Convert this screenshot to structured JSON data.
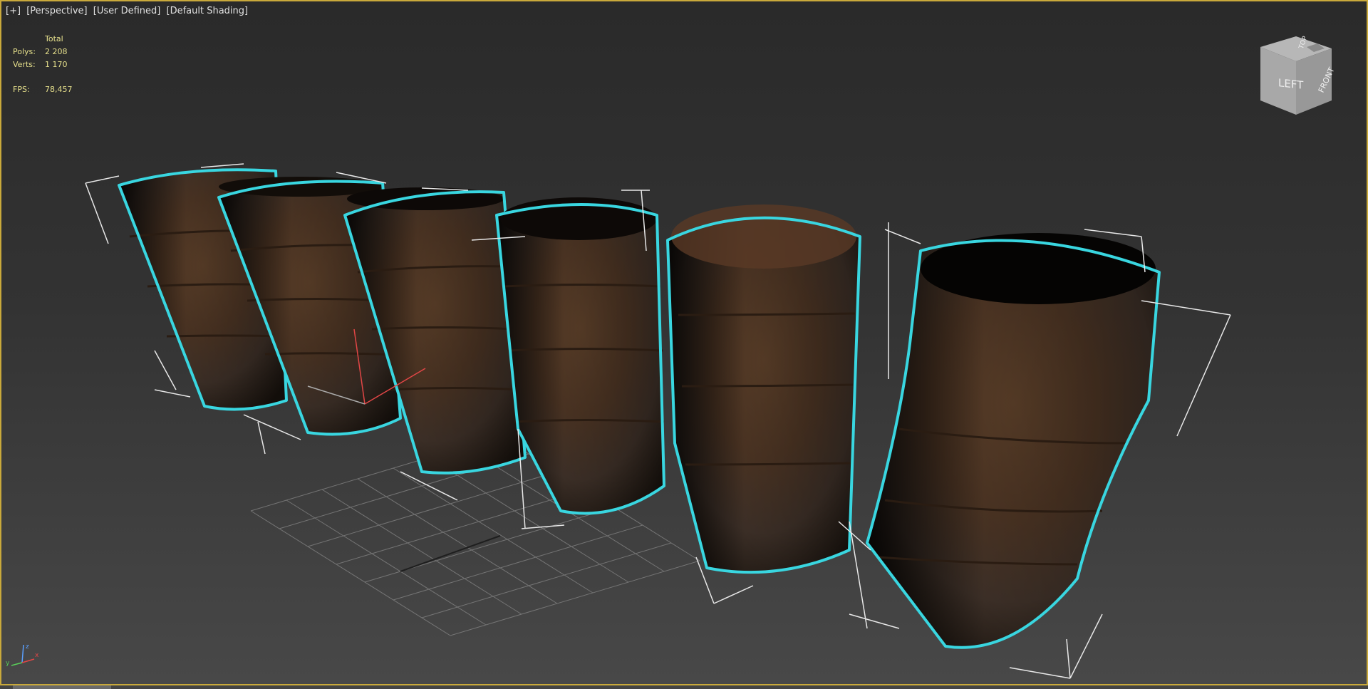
{
  "viewport": {
    "labels": [
      "[+]",
      "[Perspective]",
      "[User Defined]",
      "[Default Shading]"
    ]
  },
  "stats": {
    "header": "Total",
    "polys_label": "Polys:",
    "polys_value": "2 208",
    "verts_label": "Verts:",
    "verts_value": "1 170",
    "fps_label": "FPS:",
    "fps_value": "78,457"
  },
  "viewcube": {
    "left": "LEFT",
    "front": "FRONT",
    "top": "TOP"
  },
  "axis_tripod": {
    "x": "x",
    "y": "y",
    "z": "z"
  },
  "colors": {
    "selection": "#39d6e0",
    "viewport_border": "#c9a93b",
    "stats_text": "#e6e08c"
  }
}
